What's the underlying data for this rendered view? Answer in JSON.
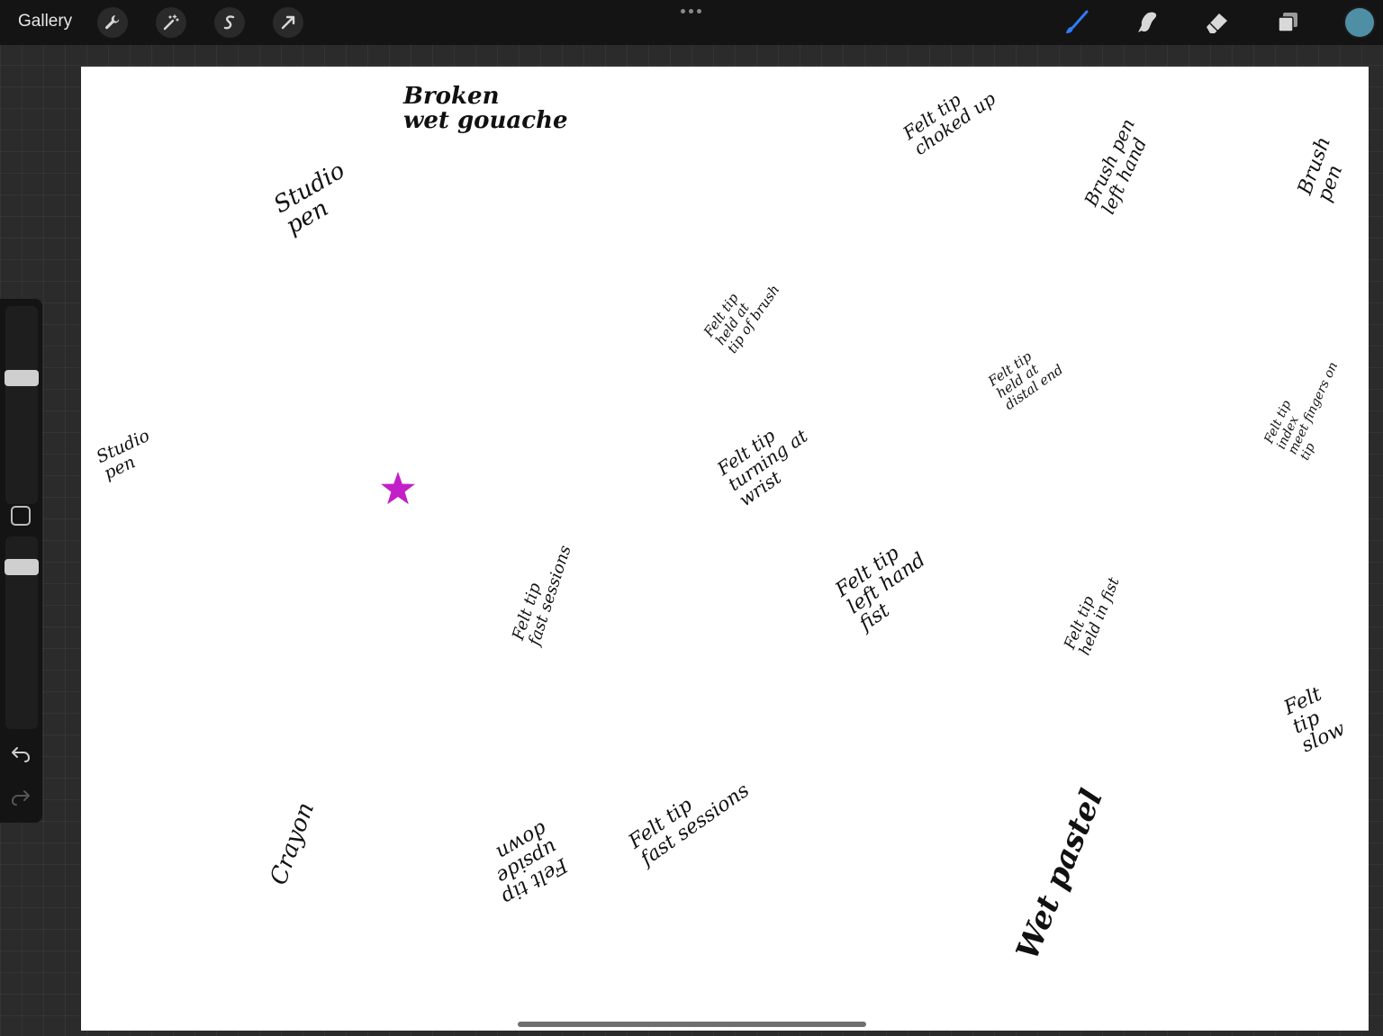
{
  "topbar": {
    "gallery_label": "Gallery",
    "left_tools": [
      {
        "name": "actions",
        "icon": "wrench-icon"
      },
      {
        "name": "adjustments",
        "icon": "magic-wand-icon"
      },
      {
        "name": "selection",
        "icon": "selection-s-icon"
      },
      {
        "name": "transform",
        "icon": "arrow-cursor-icon"
      }
    ],
    "right_tools": [
      {
        "name": "brush",
        "icon": "brush-icon",
        "active": true
      },
      {
        "name": "smudge",
        "icon": "smudge-finger-icon"
      },
      {
        "name": "eraser",
        "icon": "eraser-icon"
      },
      {
        "name": "layers",
        "icon": "layers-icon"
      }
    ],
    "active_color": "#4f8fa6",
    "accent_color": "#2f7cf6"
  },
  "sidebar": {
    "brush_size_level": 0.5,
    "opacity_level": 0.2,
    "tools": [
      "modify-button",
      "undo-arrow-icon",
      "redo-arrow-icon"
    ]
  },
  "canvas": {
    "background": "#ffffff",
    "star_color": "#c21fc8",
    "notes": {
      "studio_pen_1": "Studio\npen",
      "broken_wet_gouache": "Broken\nwet gouache",
      "felt_tip_choked": "Felt tip\nchoked up",
      "brush_pen_left": "Brush pen\nleft hand",
      "brush_pen": "Brush pen",
      "felt_tip_tip_of_brush": "Felt tip\nheld at\ntip of brush",
      "felt_tip_distal": "Felt tip\nheld at\ndistal end",
      "felt_tip_index": "Felt tip\nindex\nmeet fingers on tip",
      "studio_pen_2": "Studio\npen",
      "felt_tip_turning": "Felt tip\nturning at\nwrist",
      "felt_tip_fast": "Felt tip\nfast sessions",
      "felt_tip_left_fist": "Felt tip\nleft hand\nfist",
      "felt_tip_fist": "Felt tip\nheld in fist",
      "crayon": "Crayon",
      "felt_tip_upside": "Felt tip\nupside\ndown",
      "felt_tip_fast_2": "Felt tip\nfast sessions",
      "wet_pastel": "Wet pastel",
      "felt_tip_slow": "Felt\ntip\nslow"
    }
  }
}
